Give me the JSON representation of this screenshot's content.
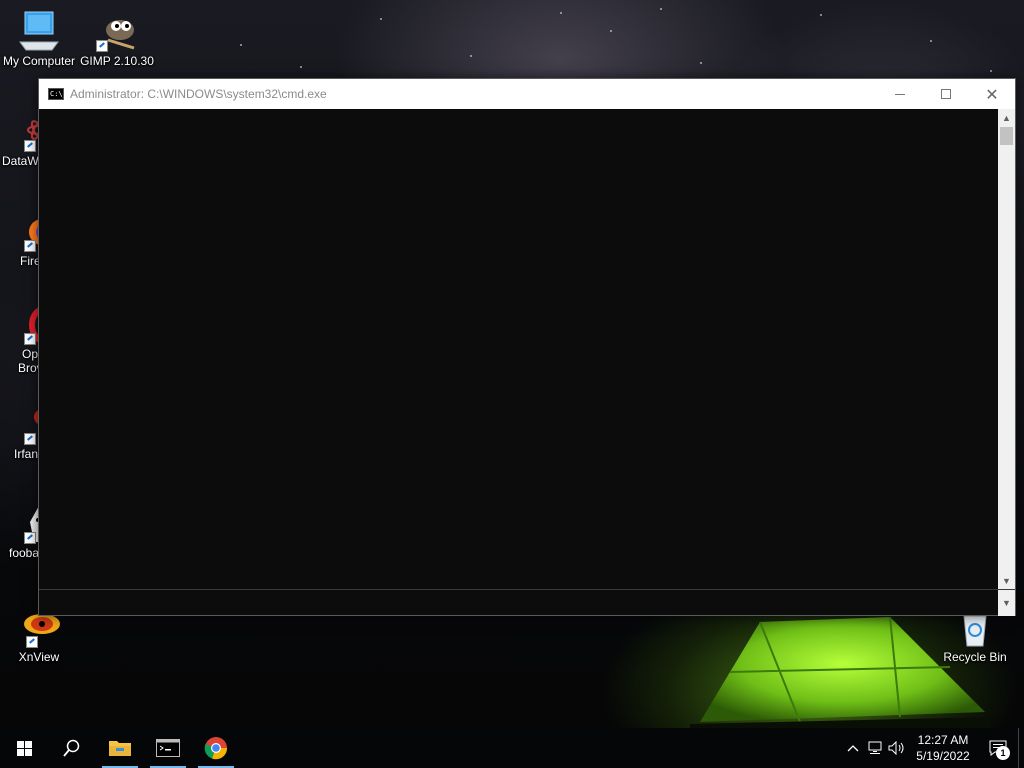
{
  "desktop": {
    "icons": [
      {
        "label": "My Computer",
        "icon": "computer-icon"
      },
      {
        "label": "GIMP 2.10.30",
        "icon": "gimp-icon"
      },
      {
        "label": "DataW",
        "icon": "datawrapper-icon"
      },
      {
        "label": "Fire",
        "icon": "firefox-icon"
      },
      {
        "label": "Op",
        "label2": "Brov",
        "icon": "opera-icon"
      },
      {
        "label": "Irfan",
        "icon": "irfanview-icon"
      },
      {
        "label": "fooba",
        "icon": "foobar-icon"
      },
      {
        "label": "XnView",
        "icon": "xnview-icon"
      },
      {
        "label": "Recycle Bin",
        "icon": "recycle-bin-icon"
      }
    ]
  },
  "window": {
    "title": "Administrator: C:\\WINDOWS\\system32\\cmd.exe",
    "app_icon_text": "C:\\_",
    "buttons": {
      "minimize": "minimize",
      "maximize": "maximize",
      "close": "✕"
    },
    "console_text": ""
  },
  "taskbar": {
    "pinned": [
      "start",
      "search",
      "file-explorer",
      "command-prompt",
      "chrome"
    ],
    "tray": {
      "chevron": "^",
      "time": "12:27 AM",
      "date": "5/19/2022",
      "notification_count": "1"
    }
  },
  "colors": {
    "console_bg": "#0c0c0c",
    "titlebar_bg": "#ffffff",
    "taskbar_bg": "#050607",
    "accent": "#76b9ed"
  }
}
